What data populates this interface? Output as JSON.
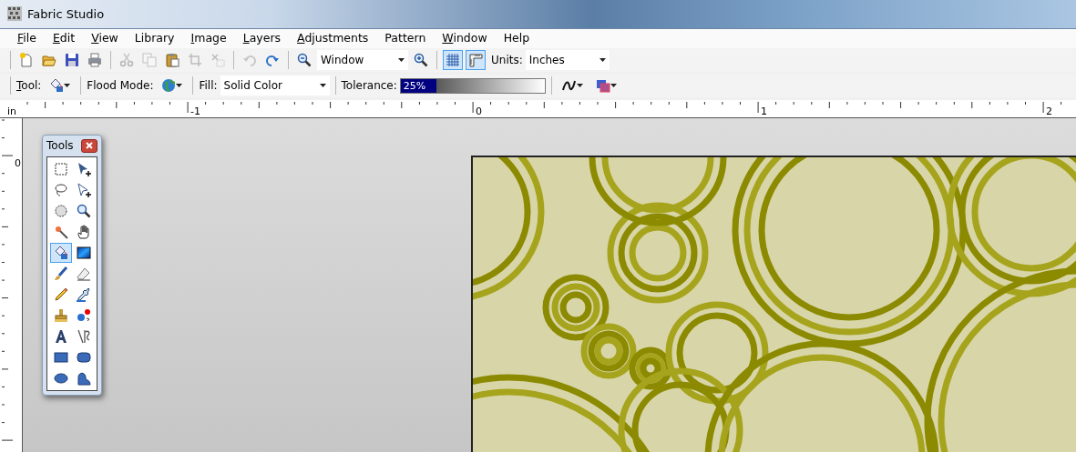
{
  "window": {
    "title": "Fabric Studio"
  },
  "menu": [
    {
      "label": "File",
      "underline": true
    },
    {
      "label": "Edit",
      "underline": true
    },
    {
      "label": "View",
      "underline": true
    },
    {
      "label": "Library",
      "underline": false
    },
    {
      "label": "Image",
      "underline": true
    },
    {
      "label": "Layers",
      "underline": true
    },
    {
      "label": "Adjustments",
      "underline": true
    },
    {
      "label": "Pattern",
      "underline": false
    },
    {
      "label": "Window",
      "underline": true
    },
    {
      "label": "Help",
      "underline": false
    }
  ],
  "toolbar": {
    "buttons": [
      {
        "disabled": false
      },
      {
        "disabled": false
      },
      {
        "disabled": false
      },
      {
        "disabled": false
      },
      {
        "disabled": true
      },
      {
        "disabled": true
      },
      {
        "disabled": false
      },
      {
        "disabled": true
      },
      {
        "disabled": true
      },
      {
        "disabled": true
      },
      {
        "disabled": false
      }
    ],
    "zoom": {
      "value": "Window"
    },
    "toggles": [
      {
        "on": true
      },
      {
        "on": true
      }
    ],
    "units": {
      "label": "Units:",
      "value": "Inches"
    }
  },
  "options_bar": {
    "tool": {
      "label": "Tool:",
      "underline": true
    },
    "flood_mode": {
      "label": "Flood Mode:"
    },
    "fill": {
      "label": "Fill:",
      "value": "Solid Color"
    },
    "tolerance": {
      "label": "Tolerance:",
      "reading": "25%",
      "level": 0.25
    }
  },
  "ruler": {
    "unit": "in",
    "labels": [
      "-1",
      "0",
      "1",
      "2"
    ],
    "vertical_labels": [
      "0"
    ]
  },
  "tools_palette": {
    "title": "Tools",
    "tools": [
      {
        "selected": false
      },
      {
        "selected": false
      },
      {
        "selected": false
      },
      {
        "selected": false
      },
      {
        "selected": false
      },
      {
        "selected": false
      },
      {
        "selected": false
      },
      {
        "selected": false
      },
      {
        "selected": true
      },
      {
        "selected": false
      },
      {
        "selected": false
      },
      {
        "selected": false
      },
      {
        "selected": false
      },
      {
        "selected": false
      },
      {
        "selected": false
      },
      {
        "selected": false
      },
      {
        "selected": false
      },
      {
        "selected": false
      },
      {
        "selected": false
      },
      {
        "selected": false
      },
      {
        "selected": false
      },
      {
        "selected": false
      }
    ]
  }
}
